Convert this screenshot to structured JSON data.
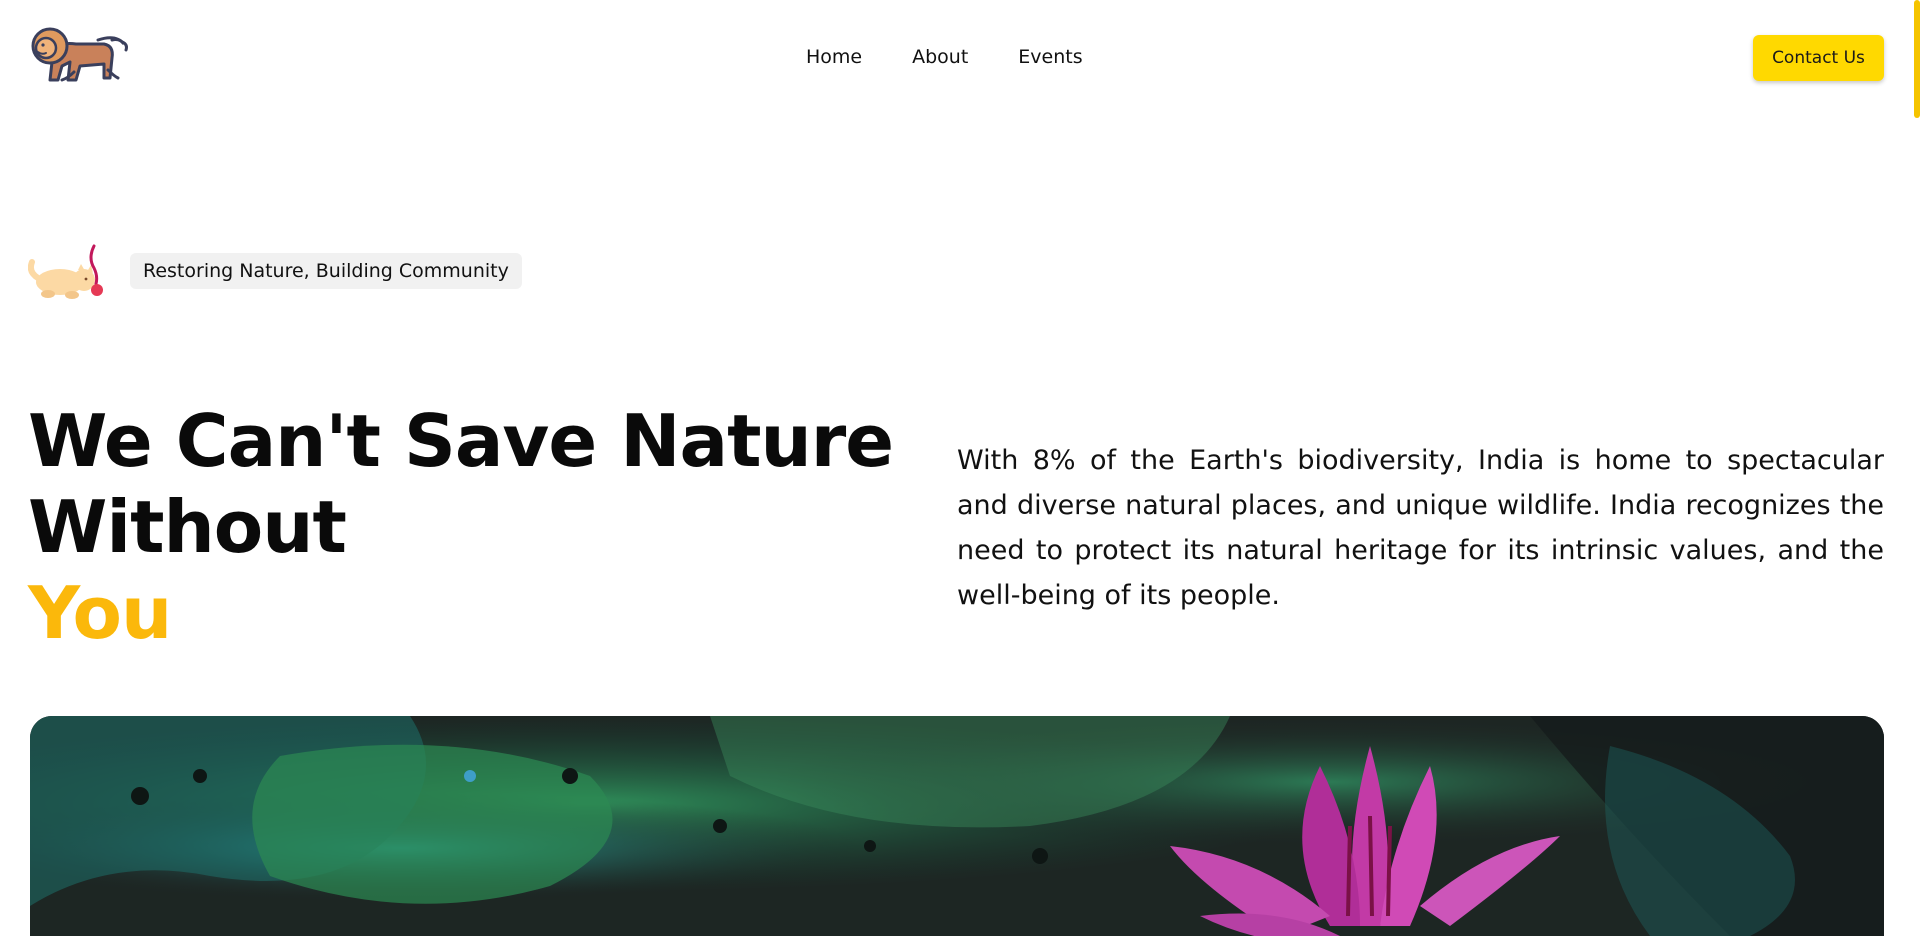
{
  "nav": {
    "logo_icon": "lion-icon",
    "items": [
      {
        "label": "Home"
      },
      {
        "label": "About"
      },
      {
        "label": "Events"
      }
    ],
    "contact_label": "Contact Us"
  },
  "badge": {
    "icon": "cat-icon",
    "label": "Restoring Nature, Building Community"
  },
  "hero": {
    "title_line1": "We Can't Save Nature",
    "title_line2": "Without",
    "title_accent": "You",
    "description": "With 8% of the Earth's biodiversity, India is home to spectacular and diverse natural places, and unique wildlife. India recognizes the need to protect its natural heritage for its intrinsic values, and the well-being of its people.",
    "image_icon": "lotus-image"
  },
  "colors": {
    "accent_yellow": "#fbb80b",
    "button_yellow": "#ffd900",
    "text": "#111111",
    "badge_bg": "#f1f1f1"
  }
}
